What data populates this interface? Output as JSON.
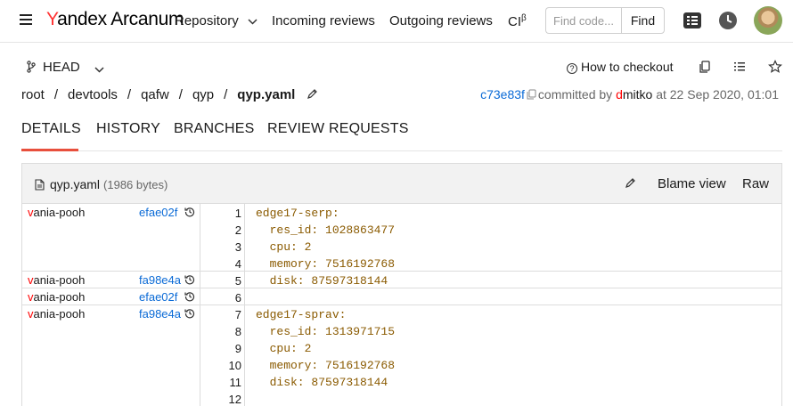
{
  "header": {
    "logo_first": "Y",
    "logo_rest": "andex Arcanum",
    "nav": {
      "repository": "Repository",
      "incoming": "Incoming reviews",
      "outgoing": "Outgoing reviews",
      "ci": "CI",
      "ci_sup": "β"
    },
    "search": {
      "placeholder": "Find code...",
      "button": "Find"
    }
  },
  "branch": {
    "name": "HEAD"
  },
  "toolbar": {
    "how_to_checkout": "How to checkout"
  },
  "breadcrumbs": [
    "root",
    "devtools",
    "qafw",
    "qyp"
  ],
  "current_file": "qyp.yaml",
  "commit": {
    "hash": "c73e83f",
    "committed_by": "committed by",
    "author_first": "d",
    "author_rest": "mitko",
    "date": "at 22 Sep 2020, 01:01"
  },
  "tabs": [
    "DETAILS",
    "HISTORY",
    "BRANCHES",
    "REVIEW REQUESTS"
  ],
  "file": {
    "name": "qyp.yaml",
    "size": "(1986 bytes)",
    "blame_view": "Blame view",
    "raw": "Raw"
  },
  "blame": [
    {
      "author_first": "v",
      "author_rest": "ania-pooh",
      "hash": "efae02f"
    },
    {
      "author_first": "v",
      "author_rest": "ania-pooh",
      "hash": "fa98e4a"
    },
    {
      "author_first": "v",
      "author_rest": "ania-pooh",
      "hash": "efae02f"
    },
    {
      "author_first": "v",
      "author_rest": "ania-pooh",
      "hash": "fa98e4a"
    }
  ],
  "lines": [
    {
      "n": "1",
      "code": "edge17-serp:"
    },
    {
      "n": "2",
      "code": "  res_id: 1028863477"
    },
    {
      "n": "3",
      "code": "  cpu: 2"
    },
    {
      "n": "4",
      "code": "  memory: 7516192768"
    },
    {
      "n": "5",
      "code": "  disk: 87597318144"
    },
    {
      "n": "6",
      "code": ""
    },
    {
      "n": "7",
      "code": "edge17-sprav:"
    },
    {
      "n": "8",
      "code": "  res_id: 1313971715"
    },
    {
      "n": "9",
      "code": "  cpu: 2"
    },
    {
      "n": "10",
      "code": "  memory: 7516192768"
    },
    {
      "n": "11",
      "code": "  disk: 87597318144"
    },
    {
      "n": "12",
      "code": ""
    }
  ],
  "colors": {
    "accent": "#e84f3c",
    "link": "#0a6ad6",
    "code": "#8a5a00",
    "author_initial": "#ff0000"
  }
}
